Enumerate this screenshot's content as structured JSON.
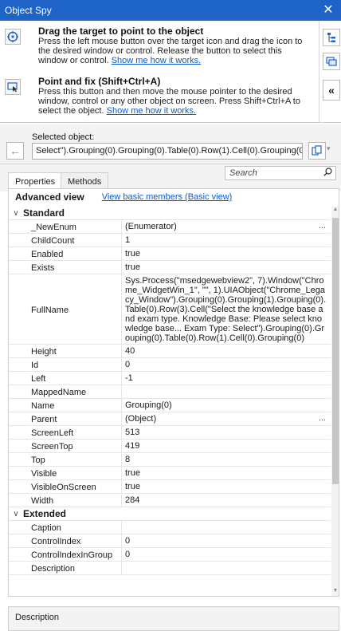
{
  "window": {
    "title": "Object Spy",
    "close_glyph": "✕"
  },
  "tools": {
    "drag": {
      "title": "Drag the target to point to the object",
      "desc": "Press the left mouse button over the target icon and drag the icon to the desired window or control. Release the button to select this window or control.",
      "link": "Show me how it works."
    },
    "point": {
      "title": "Point and fix (Shift+Ctrl+A)",
      "desc": "Press this button and then move the mouse pointer to the desired window, control or any other object on screen. Press Shift+Ctrl+A to select the object.",
      "link": "Show me how it works."
    }
  },
  "selected": {
    "label": "Selected object:",
    "value": "Select\").Grouping(0).Grouping(0).Table(0).Row(1).Cell(0).Grouping(0)"
  },
  "tabs": {
    "properties": "Properties",
    "methods": "Methods"
  },
  "search": {
    "placeholder": "Search"
  },
  "advanced": {
    "title": "Advanced view",
    "link": "View basic members (Basic view)"
  },
  "categories": {
    "standard": "Standard",
    "extended": "Extended"
  },
  "properties": {
    "standard": [
      {
        "name": "_NewEnum",
        "value": "(Enumerator)",
        "dots": "..."
      },
      {
        "name": "ChildCount",
        "value": "1"
      },
      {
        "name": "Enabled",
        "value": "true"
      },
      {
        "name": "Exists",
        "value": "true"
      },
      {
        "name": "FullName",
        "value": "Sys.Process(\"msedgewebview2\", 7).Window(\"Chrome_WidgetWin_1\", \"\", 1).UIAObject(\"Chrome_Legacy_Window\").Grouping(0).Grouping(1).Grouping(0).Table(0).Row(3).Cell(\"Select the knowledge base and exam type. Knowledge Base: Please select knowledge base... Exam Type: Select\").Grouping(0).Grouping(0).Table(0).Row(1).Cell(0).Grouping(0)"
      },
      {
        "name": "Height",
        "value": "40"
      },
      {
        "name": "Id",
        "value": "0"
      },
      {
        "name": "Left",
        "value": "-1"
      },
      {
        "name": "MappedName",
        "value": ""
      },
      {
        "name": "Name",
        "value": "Grouping(0)"
      },
      {
        "name": "Parent",
        "value": "(Object)",
        "dots": "..."
      },
      {
        "name": "ScreenLeft",
        "value": "513"
      },
      {
        "name": "ScreenTop",
        "value": "419"
      },
      {
        "name": "Top",
        "value": "8"
      },
      {
        "name": "Visible",
        "value": "true"
      },
      {
        "name": "VisibleOnScreen",
        "value": "true"
      },
      {
        "name": "Width",
        "value": "284"
      }
    ],
    "extended": [
      {
        "name": "Caption",
        "value": ""
      },
      {
        "name": "ControlIndex",
        "value": "0"
      },
      {
        "name": "ControlIndexInGroup",
        "value": "0"
      },
      {
        "name": "Description",
        "value": ""
      }
    ]
  },
  "description_panel": {
    "label": "Description"
  },
  "icons": {
    "drag_target": "crosshair-icon",
    "point_fix": "point-fix-icon",
    "tree": "object-tree-icon",
    "browser": "object-browser-icon",
    "collapse": "«",
    "back": "←",
    "copy": "copy-icon",
    "search": "search-icon"
  },
  "colors": {
    "titlebar": "#1e64c8",
    "link": "#0b5ad0",
    "accent": "#0b5ad0"
  }
}
